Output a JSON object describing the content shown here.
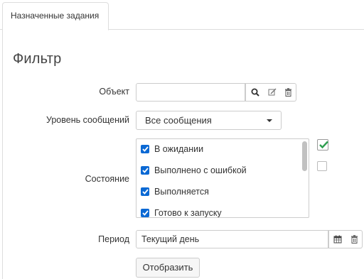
{
  "tabs": [
    {
      "label": "Назначенные задания"
    }
  ],
  "filter": {
    "title": "Фильтр",
    "object": {
      "label": "Объект",
      "value": ""
    },
    "message_level": {
      "label": "Уровень сообщений",
      "selected": "Все сообщения"
    },
    "state": {
      "label": "Состояние",
      "options": [
        {
          "label": "В ожидании",
          "checked": true
        },
        {
          "label": "Выполнено с ошибкой",
          "checked": true
        },
        {
          "label": "Выполняется",
          "checked": true
        },
        {
          "label": "Готово к запуску",
          "checked": true
        }
      ]
    },
    "period": {
      "label": "Период",
      "value": "Текущий день"
    },
    "submit_label": "Отобразить"
  },
  "colors": {
    "accent": "#0b69d4",
    "success": "#2e9e4f"
  },
  "icons": [
    "search-icon",
    "edit-icon",
    "trash-icon",
    "calendar-icon",
    "check-icon",
    "caret-down-icon"
  ]
}
